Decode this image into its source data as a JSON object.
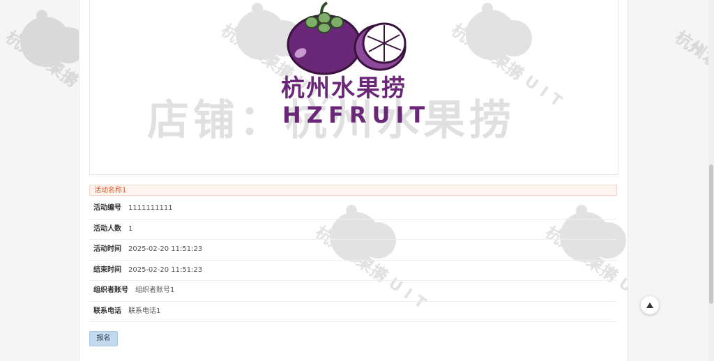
{
  "banner": {
    "brand_cn": "杭州水果捞",
    "brand_en": "HZFRUIT",
    "shop_watermark": "店铺：杭州水果捞"
  },
  "watermark": {
    "text_cn": "杭州水果捞",
    "text_en": "HZFRUIT"
  },
  "activity": {
    "title": "活动名称1",
    "fields": [
      {
        "label": "活动编号",
        "value": "1111111111"
      },
      {
        "label": "活动人数",
        "value": "1"
      },
      {
        "label": "活动时间",
        "value": "2025-02-20 11:51:23"
      },
      {
        "label": "结束时间",
        "value": "2025-02-20 11:51:23"
      },
      {
        "label": "组织者账号",
        "value": "组织者账号1"
      },
      {
        "label": "联系电话",
        "value": "联系电话1"
      }
    ]
  },
  "buttons": {
    "signup_label": "报名"
  },
  "colors": {
    "brand_purple": "#6a2777",
    "title_orange": "#e0561a",
    "button_blue": "#c3d9ee"
  }
}
